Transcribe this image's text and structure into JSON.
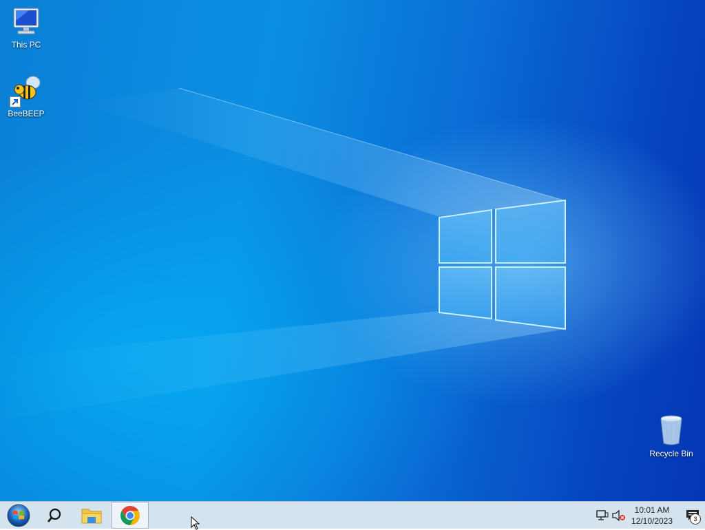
{
  "desktop": {
    "icons": [
      {
        "label": "This PC",
        "icon": "computer-icon"
      },
      {
        "label": "BeeBEEP",
        "icon": "bee-icon"
      },
      {
        "label": "Recycle Bin",
        "icon": "recycle-bin-icon"
      }
    ]
  },
  "taskbar": {
    "start_icon": "windows-orb-icon",
    "search_icon": "search-icon",
    "pinned": [
      {
        "name": "File Explorer",
        "icon": "folder-icon"
      },
      {
        "name": "Google Chrome",
        "icon": "chrome-icon",
        "active": true
      }
    ],
    "tray": {
      "network_icon": "network-icon",
      "volume_icon": "volume-muted-icon",
      "time": "10:01 AM",
      "date": "12/10/2023",
      "notifications_count": "3"
    }
  },
  "colors": {
    "taskbar_bg": "#d5e3ee",
    "desktop_blue": "#0a7fd6"
  }
}
